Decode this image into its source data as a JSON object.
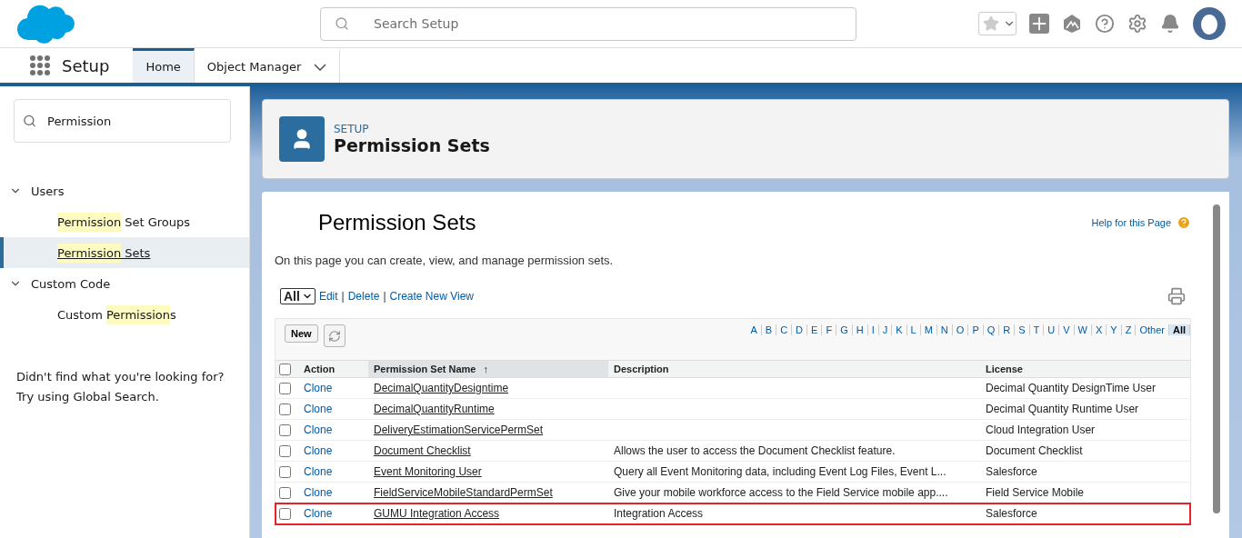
{
  "header": {
    "search": {
      "placeholder": "Search Setup"
    }
  },
  "nav": {
    "app_name": "Setup",
    "tabs": [
      {
        "label": "Home",
        "selected": true,
        "dropdown": false
      },
      {
        "label": "Object Manager",
        "selected": false,
        "dropdown": true
      }
    ]
  },
  "sidebar": {
    "search": {
      "value": "Permission"
    },
    "groups": [
      {
        "label": "Users",
        "expanded": true,
        "children": [
          {
            "parts": [
              {
                "text": "Permission",
                "match": true
              },
              {
                "text": " Set Groups",
                "match": false
              }
            ],
            "selected": false
          },
          {
            "parts": [
              {
                "text": "Permission",
                "match": true
              },
              {
                "text": " Sets",
                "match": false
              }
            ],
            "selected": true
          }
        ]
      },
      {
        "label": "Custom Code",
        "expanded": true,
        "children": [
          {
            "parts": [
              {
                "text": "Custom ",
                "match": false
              },
              {
                "text": "Permission",
                "match": true
              },
              {
                "text": "s",
                "match": false
              }
            ],
            "selected": false
          }
        ]
      }
    ],
    "hint": [
      "Didn't find what you're looking for?",
      "Try using Global Search."
    ]
  },
  "page_header": {
    "eyebrow": "SETUP",
    "title": "Permission Sets"
  },
  "content": {
    "title": "Permission Sets",
    "help": "Help for this Page",
    "intro": "On this page you can create, view, and manage permission sets.",
    "view": {
      "value": "All",
      "links": [
        "Edit",
        "Delete",
        "Create New View"
      ],
      "separators": [
        "|",
        "|"
      ]
    },
    "new_button": "New",
    "letters": [
      {
        "label": "A",
        "selected": false
      },
      {
        "label": "B",
        "selected": false
      },
      {
        "label": "C",
        "selected": false
      },
      {
        "label": "D",
        "selected": false
      },
      {
        "label": "E",
        "selected": false
      },
      {
        "label": "F",
        "selected": false
      },
      {
        "label": "G",
        "selected": false
      },
      {
        "label": "H",
        "selected": false
      },
      {
        "label": "I",
        "selected": false
      },
      {
        "label": "J",
        "selected": false
      },
      {
        "label": "K",
        "selected": false
      },
      {
        "label": "L",
        "selected": false
      },
      {
        "label": "M",
        "selected": false
      },
      {
        "label": "N",
        "selected": false
      },
      {
        "label": "O",
        "selected": false
      },
      {
        "label": "P",
        "selected": false
      },
      {
        "label": "Q",
        "selected": false
      },
      {
        "label": "R",
        "selected": false
      },
      {
        "label": "S",
        "selected": false
      },
      {
        "label": "T",
        "selected": false
      },
      {
        "label": "U",
        "selected": false
      },
      {
        "label": "V",
        "selected": false
      },
      {
        "label": "W",
        "selected": false
      },
      {
        "label": "X",
        "selected": false
      },
      {
        "label": "Y",
        "selected": false
      },
      {
        "label": "Z",
        "selected": false
      },
      {
        "label": "Other",
        "selected": false
      },
      {
        "label": "All",
        "selected": true
      }
    ],
    "table": {
      "select_all_checked": false,
      "sort_arrow": "↑",
      "columns": [
        {
          "label": "Action",
          "sorted": false
        },
        {
          "label": "Permission Set Name",
          "sorted": true
        },
        {
          "label": "Description",
          "sorted": false
        },
        {
          "label": "License",
          "sorted": false
        }
      ],
      "rows": [
        {
          "checked": false,
          "action": "Clone",
          "name": "DecimalQuantityDesigntime",
          "description": "",
          "license": "Decimal Quantity DesignTime User",
          "outlined": false
        },
        {
          "checked": false,
          "action": "Clone",
          "name": "DecimalQuantityRuntime",
          "description": "",
          "license": "Decimal Quantity Runtime User",
          "outlined": false
        },
        {
          "checked": false,
          "action": "Clone",
          "name": "DeliveryEstimationServicePermSet",
          "description": "",
          "license": "Cloud Integration User",
          "outlined": false
        },
        {
          "checked": false,
          "action": "Clone",
          "name": "Document Checklist",
          "description": "Allows the user to access the Document Checklist feature.",
          "license": "Document Checklist",
          "outlined": false
        },
        {
          "checked": false,
          "action": "Clone",
          "name": "Event Monitoring User",
          "description": "Query all Event Monitoring data, including Event Log Files, Event L...",
          "license": "Salesforce",
          "outlined": false
        },
        {
          "checked": false,
          "action": "Clone",
          "name": "FieldServiceMobileStandardPermSet",
          "description": "Give your mobile workforce access to the Field Service mobile app....",
          "license": "Field Service Mobile",
          "outlined": false
        },
        {
          "checked": false,
          "action": "Clone",
          "name": "GUMU Integration Access",
          "description": "Integration Access",
          "license": "Salesforce",
          "outlined": true
        }
      ]
    }
  }
}
